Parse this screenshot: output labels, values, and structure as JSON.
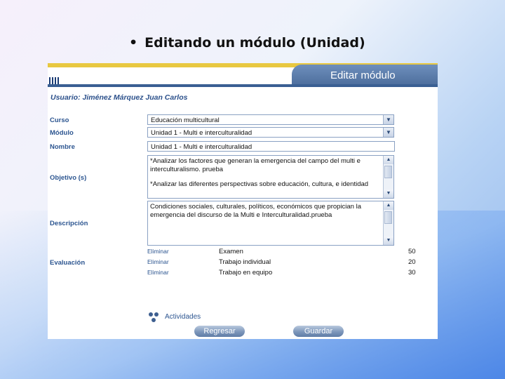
{
  "slide": {
    "bullet": "•",
    "title": "Editando un módulo (Unidad)"
  },
  "header": {
    "title": "Editar módulo"
  },
  "user": {
    "line": "Usuario: Jiménez Márquez Juan Carlos"
  },
  "form": {
    "labels": {
      "curso": "Curso",
      "modulo": "Módulo",
      "nombre": "Nombre",
      "objetivo": "Objetivo (s)",
      "descripcion": "Descripción",
      "evaluacion": "Evaluación"
    },
    "curso_value": "Educación multicultural",
    "modulo_value": "Unidad 1 - Multi e interculturalidad",
    "nombre_value": "Unidad 1 - Multi e interculturalidad",
    "objetivo_text_1": "*Analizar los factores que generan la emergencia del campo del multi e interculturalismo. prueba",
    "objetivo_text_2": "*Analizar las diferentes perspectivas sobre educación, cultura, e identidad",
    "descripcion_text": "Condiciones sociales, culturales, políticos, económicos que propician la emergencia del discurso de la Multi e Interculturalidad.prueba"
  },
  "evaluacion": {
    "delete_label": "Eliminar",
    "rows": [
      {
        "name": "Examen",
        "pct": "50"
      },
      {
        "name": "Trabajo individual",
        "pct": "20"
      },
      {
        "name": "Trabajo en equipo",
        "pct": "30"
      }
    ]
  },
  "actividades_label": "Actividades",
  "buttons": {
    "regresar": "Regresar",
    "guardar": "Guardar"
  },
  "colors": {
    "accent": "#2c5590",
    "header": "#4a6b9a",
    "top_line": "#e8c840"
  }
}
